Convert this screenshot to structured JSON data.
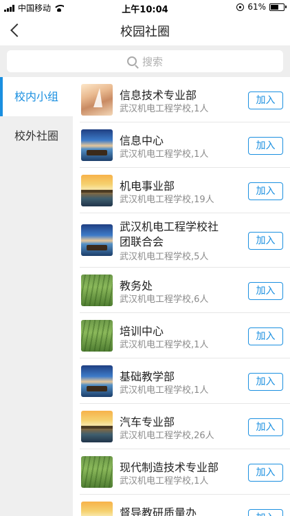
{
  "status_bar": {
    "carrier": "中国移动",
    "time": "上午10:04",
    "battery_percent": "61%",
    "battery_level": 0.61
  },
  "nav": {
    "title": "校园社圈",
    "back_icon": "chevron-left-icon"
  },
  "search": {
    "placeholder": "搜索",
    "icon": "search-icon"
  },
  "sidebar": {
    "items": [
      {
        "label": "校内小组",
        "active": true
      },
      {
        "label": "校外社圈",
        "active": false
      }
    ]
  },
  "groups": [
    {
      "name": "信息技术专业部",
      "meta": "武汉机电工程学校,1人",
      "thumb": "sailboat",
      "button": "加入"
    },
    {
      "name": "信息中心",
      "meta": "武汉机电工程学校,1人",
      "thumb": "pier",
      "button": "加入"
    },
    {
      "name": "机电事业部",
      "meta": "武汉机电工程学校,19人",
      "thumb": "sunset",
      "button": "加入"
    },
    {
      "name": "武汉机电工程学校社团联合会",
      "meta": "武汉机电工程学校,5人",
      "thumb": "pier",
      "button": "加入"
    },
    {
      "name": "教务处",
      "meta": "武汉机电工程学校,6人",
      "thumb": "grass",
      "button": "加入"
    },
    {
      "name": "培训中心",
      "meta": "武汉机电工程学校,1人",
      "thumb": "grass",
      "button": "加入"
    },
    {
      "name": "基础教学部",
      "meta": "武汉机电工程学校,1人",
      "thumb": "pier",
      "button": "加入"
    },
    {
      "name": "汽车专业部",
      "meta": "武汉机电工程学校,26人",
      "thumb": "sunset",
      "button": "加入"
    },
    {
      "name": "现代制造技术专业部",
      "meta": "武汉机电工程学校,1人",
      "thumb": "grass",
      "button": "加入"
    },
    {
      "name": "督导教研质量办",
      "meta": "",
      "thumb": "sunset",
      "button": "加入"
    }
  ],
  "colors": {
    "accent": "#1a8fe0",
    "sidebar_bg": "#efefef",
    "search_bg": "#eeeeee"
  }
}
